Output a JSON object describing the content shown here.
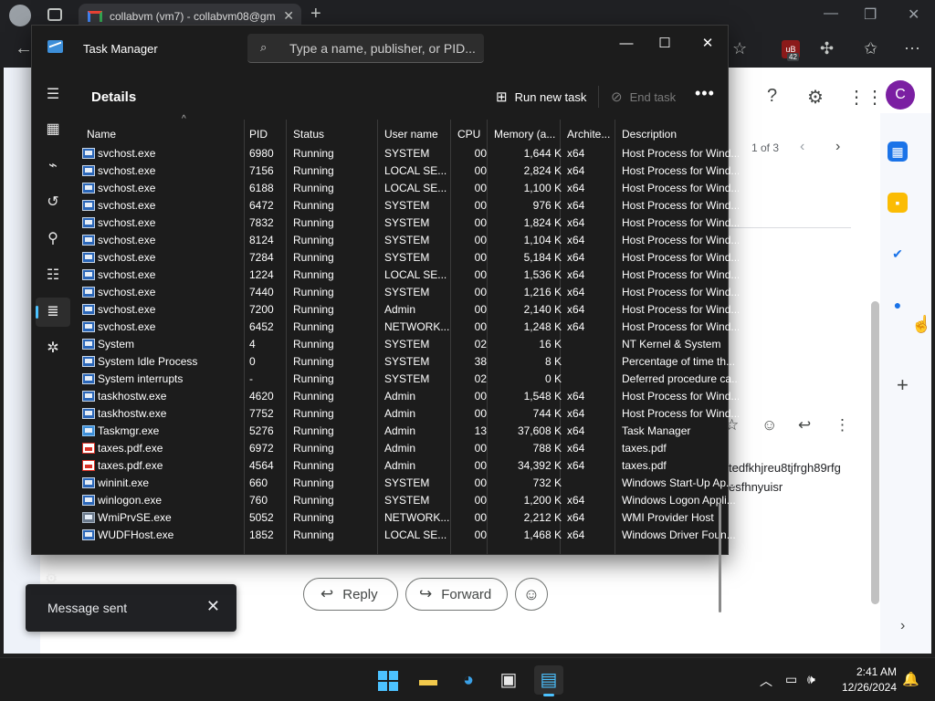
{
  "browser": {
    "tab_title": "collabvm (vm7) - collabvm08@gm",
    "tab_close": "✕",
    "new_tab": "+",
    "extension_badge": "42",
    "window_controls": {
      "minimize": "—",
      "restore": "❐",
      "close": "✕"
    }
  },
  "gmail": {
    "pager_text": "1 of 3",
    "avatar_letter": "C",
    "mail_body_line1": "tedfkhjreu8tjfrgh89rfg",
    "mail_body_line2": "esfhnyuisr",
    "reply_label": "Reply",
    "forward_label": "Forward",
    "toast_text": "Message sent"
  },
  "task_manager": {
    "title": "Task Manager",
    "search_placeholder": "Type a name, publisher, or PID...",
    "page_title": "Details",
    "run_new_task_label": "Run new task",
    "end_task_label": "End task",
    "more_label": "•••",
    "columns": [
      "Name",
      "PID",
      "Status",
      "User name",
      "CPU",
      "Memory (a...",
      "Archite...",
      "Description"
    ],
    "rows": [
      {
        "icon": "service",
        "name": "svchost.exe",
        "pid": "6980",
        "status": "Running",
        "user": "SYSTEM",
        "cpu": "00",
        "memory": "1,644 K",
        "arch": "x64",
        "desc": "Host Process for Wind..."
      },
      {
        "icon": "service",
        "name": "svchost.exe",
        "pid": "7156",
        "status": "Running",
        "user": "LOCAL SE...",
        "cpu": "00",
        "memory": "2,824 K",
        "arch": "x64",
        "desc": "Host Process for Wind..."
      },
      {
        "icon": "service",
        "name": "svchost.exe",
        "pid": "6188",
        "status": "Running",
        "user": "LOCAL SE...",
        "cpu": "00",
        "memory": "1,100 K",
        "arch": "x64",
        "desc": "Host Process for Wind..."
      },
      {
        "icon": "service",
        "name": "svchost.exe",
        "pid": "6472",
        "status": "Running",
        "user": "SYSTEM",
        "cpu": "00",
        "memory": "976 K",
        "arch": "x64",
        "desc": "Host Process for Wind..."
      },
      {
        "icon": "service",
        "name": "svchost.exe",
        "pid": "7832",
        "status": "Running",
        "user": "SYSTEM",
        "cpu": "00",
        "memory": "1,824 K",
        "arch": "x64",
        "desc": "Host Process for Wind..."
      },
      {
        "icon": "service",
        "name": "svchost.exe",
        "pid": "8124",
        "status": "Running",
        "user": "SYSTEM",
        "cpu": "00",
        "memory": "1,104 K",
        "arch": "x64",
        "desc": "Host Process for Wind..."
      },
      {
        "icon": "service",
        "name": "svchost.exe",
        "pid": "7284",
        "status": "Running",
        "user": "SYSTEM",
        "cpu": "00",
        "memory": "5,184 K",
        "arch": "x64",
        "desc": "Host Process for Wind..."
      },
      {
        "icon": "service",
        "name": "svchost.exe",
        "pid": "1224",
        "status": "Running",
        "user": "LOCAL SE...",
        "cpu": "00",
        "memory": "1,536 K",
        "arch": "x64",
        "desc": "Host Process for Wind..."
      },
      {
        "icon": "service",
        "name": "svchost.exe",
        "pid": "7440",
        "status": "Running",
        "user": "SYSTEM",
        "cpu": "00",
        "memory": "1,216 K",
        "arch": "x64",
        "desc": "Host Process for Wind..."
      },
      {
        "icon": "service",
        "name": "svchost.exe",
        "pid": "7200",
        "status": "Running",
        "user": "Admin",
        "cpu": "00",
        "memory": "2,140 K",
        "arch": "x64",
        "desc": "Host Process for Wind..."
      },
      {
        "icon": "service",
        "name": "svchost.exe",
        "pid": "6452",
        "status": "Running",
        "user": "NETWORK...",
        "cpu": "00",
        "memory": "1,248 K",
        "arch": "x64",
        "desc": "Host Process for Wind..."
      },
      {
        "icon": "service",
        "name": "System",
        "pid": "4",
        "status": "Running",
        "user": "SYSTEM",
        "cpu": "02",
        "memory": "16 K",
        "arch": "",
        "desc": "NT Kernel & System"
      },
      {
        "icon": "service",
        "name": "System Idle Process",
        "pid": "0",
        "status": "Running",
        "user": "SYSTEM",
        "cpu": "38",
        "memory": "8 K",
        "arch": "",
        "desc": "Percentage of time th..."
      },
      {
        "icon": "service",
        "name": "System interrupts",
        "pid": "-",
        "status": "Running",
        "user": "SYSTEM",
        "cpu": "02",
        "memory": "0 K",
        "arch": "",
        "desc": "Deferred procedure ca..."
      },
      {
        "icon": "service",
        "name": "taskhostw.exe",
        "pid": "4620",
        "status": "Running",
        "user": "Admin",
        "cpu": "00",
        "memory": "1,548 K",
        "arch": "x64",
        "desc": "Host Process for Wind..."
      },
      {
        "icon": "service",
        "name": "taskhostw.exe",
        "pid": "7752",
        "status": "Running",
        "user": "Admin",
        "cpu": "00",
        "memory": "744 K",
        "arch": "x64",
        "desc": "Host Process for Wind..."
      },
      {
        "icon": "taskmgr",
        "name": "Taskmgr.exe",
        "pid": "5276",
        "status": "Running",
        "user": "Admin",
        "cpu": "13",
        "memory": "37,608 K",
        "arch": "x64",
        "desc": "Task Manager"
      },
      {
        "icon": "pdf",
        "name": "taxes.pdf.exe",
        "pid": "6972",
        "status": "Running",
        "user": "Admin",
        "cpu": "00",
        "memory": "788 K",
        "arch": "x64",
        "desc": "taxes.pdf"
      },
      {
        "icon": "pdf",
        "name": "taxes.pdf.exe",
        "pid": "4564",
        "status": "Running",
        "user": "Admin",
        "cpu": "00",
        "memory": "34,392 K",
        "arch": "x64",
        "desc": "taxes.pdf"
      },
      {
        "icon": "service",
        "name": "wininit.exe",
        "pid": "660",
        "status": "Running",
        "user": "SYSTEM",
        "cpu": "00",
        "memory": "732 K",
        "arch": "",
        "desc": "Windows Start-Up Ap..."
      },
      {
        "icon": "service",
        "name": "winlogon.exe",
        "pid": "760",
        "status": "Running",
        "user": "SYSTEM",
        "cpu": "00",
        "memory": "1,200 K",
        "arch": "x64",
        "desc": "Windows Logon Appli..."
      },
      {
        "icon": "wmi",
        "name": "WmiPrvSE.exe",
        "pid": "5052",
        "status": "Running",
        "user": "NETWORK...",
        "cpu": "00",
        "memory": "2,212 K",
        "arch": "x64",
        "desc": "WMI Provider Host"
      },
      {
        "icon": "service",
        "name": "WUDFHost.exe",
        "pid": "1852",
        "status": "Running",
        "user": "LOCAL SE...",
        "cpu": "00",
        "memory": "1,468 K",
        "arch": "x64",
        "desc": "Windows Driver Foun..."
      }
    ]
  },
  "taskbar": {
    "time": "2:41 AM",
    "date": "12/26/2024"
  },
  "colors": {
    "accent": "#4cc2ff",
    "tm_background": "#1c1c1c",
    "toast_background": "#202124",
    "gmail_avatar": "#7b1fa2"
  },
  "icons": [
    "search-icon",
    "hamburger-icon",
    "processes-icon",
    "performance-icon",
    "history-icon",
    "startup-icon",
    "users-icon",
    "details-icon",
    "services-icon",
    "settings-icon",
    "run-task-icon",
    "end-task-icon"
  ]
}
